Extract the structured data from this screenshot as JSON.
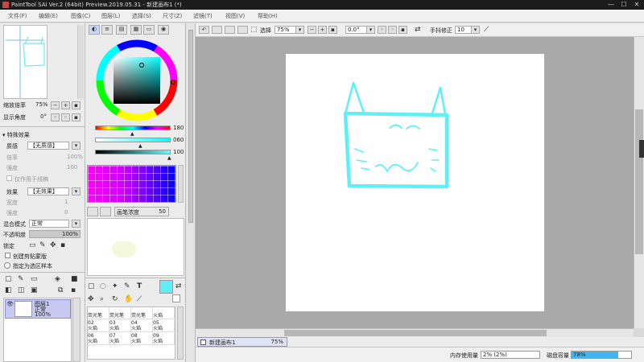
{
  "titlebar": {
    "title": "PaintTool SAI Ver.2 (64bit) Preview.2019.05.31 - 新建画布1 (*)",
    "min": "—",
    "max": "☐",
    "close": "✕"
  },
  "menu": [
    "文件(F)",
    "编辑(E)",
    "图像(C)",
    "图层(L)",
    "选择(S)",
    "尺寸(Z)",
    "滤镜(T)",
    "视图(V)",
    "帮助(H)"
  ],
  "navigator": {
    "zoom_label": "缩放倍率",
    "zoom_value": "75%",
    "angle_label": "显示角度",
    "angle_value": "0°"
  },
  "layer_props": {
    "section": "特殊效果",
    "texture_label": "质感",
    "texture_value": "【无质感】",
    "scale_label": "倍率",
    "scale_value": "100%",
    "strength_label": "强度",
    "strength_value": "100",
    "apply_label": "仅作用于线稿",
    "effect_label": "效果",
    "effect_value": "【无效果】",
    "width_label": "宽度",
    "width_value": "1",
    "effect_strength_label": "强度",
    "effect_strength_value": "0",
    "blend_label": "混合模式",
    "blend_value": "正常",
    "opacity_label": "不透明度",
    "opacity_value": "100%",
    "lock_label": "锁定",
    "clip_label": "创建剪贴蒙版",
    "selection_label": "指定为选区样本"
  },
  "layer": {
    "name": "图层1",
    "mode": "正常",
    "opacity": "100%"
  },
  "color": {
    "h_label": "H",
    "h_value": "180",
    "s_label": "S",
    "s_value": "060",
    "v_label": "V",
    "v_value": "100",
    "current": "#5ff0f7"
  },
  "brush_size": {
    "label": "画笔浓度",
    "value": "50"
  },
  "brushes": [
    {
      "num": "",
      "name": "荧光笔"
    },
    {
      "num": "",
      "name": "荧光笔"
    },
    {
      "num": "",
      "name": "荧光笔"
    },
    {
      "num": "",
      "name": "火焰"
    },
    {
      "num": "02",
      "name": "火焰"
    },
    {
      "num": "03",
      "name": "火焰"
    },
    {
      "num": "04",
      "name": "火焰"
    },
    {
      "num": "05",
      "name": "火焰"
    },
    {
      "num": "06",
      "name": "火焰"
    },
    {
      "num": "07",
      "name": "火焰"
    },
    {
      "num": "08",
      "name": "火焰"
    },
    {
      "num": "09",
      "name": "火焰"
    }
  ],
  "toolbar": {
    "select_label": "选择",
    "zoom_value": "75%",
    "angle_value": "0.0°",
    "stabilizer_label": "手抖修正",
    "stabilizer_value": "10"
  },
  "status": {
    "canvas_name": "新建画布1",
    "canvas_zoom": "75%",
    "mem_label": "内存使用量",
    "mem_value": "2% (2%)",
    "disk_label": "磁盘容量",
    "disk_value": "78%",
    "disk_fraction": 0.78
  }
}
